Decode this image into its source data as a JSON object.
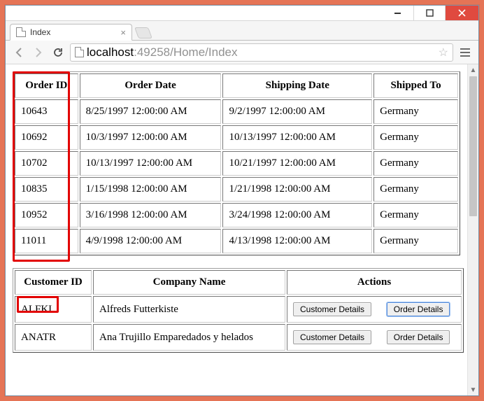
{
  "window": {
    "tab_title": "Index"
  },
  "addressbar": {
    "host": "localhost",
    "rest": ":49258/Home/Index"
  },
  "orders_table": {
    "headers": {
      "order_id": "Order ID",
      "order_date": "Order Date",
      "shipping_date": "Shipping Date",
      "shipped_to": "Shipped To"
    },
    "rows": [
      {
        "order_id": "10643",
        "order_date": "8/25/1997 12:00:00 AM",
        "shipping_date": "9/2/1997 12:00:00 AM",
        "shipped_to": "Germany"
      },
      {
        "order_id": "10692",
        "order_date": "10/3/1997 12:00:00 AM",
        "shipping_date": "10/13/1997 12:00:00 AM",
        "shipped_to": "Germany"
      },
      {
        "order_id": "10702",
        "order_date": "10/13/1997 12:00:00 AM",
        "shipping_date": "10/21/1997 12:00:00 AM",
        "shipped_to": "Germany"
      },
      {
        "order_id": "10835",
        "order_date": "1/15/1998 12:00:00 AM",
        "shipping_date": "1/21/1998 12:00:00 AM",
        "shipped_to": "Germany"
      },
      {
        "order_id": "10952",
        "order_date": "3/16/1998 12:00:00 AM",
        "shipping_date": "3/24/1998 12:00:00 AM",
        "shipped_to": "Germany"
      },
      {
        "order_id": "11011",
        "order_date": "4/9/1998 12:00:00 AM",
        "shipping_date": "4/13/1998 12:00:00 AM",
        "shipped_to": "Germany"
      }
    ]
  },
  "customers_table": {
    "headers": {
      "customer_id": "Customer ID",
      "company_name": "Company Name",
      "actions": "Actions"
    },
    "action_labels": {
      "customer_details": "Customer Details",
      "order_details": "Order Details"
    },
    "rows": [
      {
        "customer_id": "ALFKI",
        "company_name": "Alfreds Futterkiste"
      },
      {
        "customer_id": "ANATR",
        "company_name": "Ana Trujillo Emparedados y helados"
      }
    ]
  }
}
